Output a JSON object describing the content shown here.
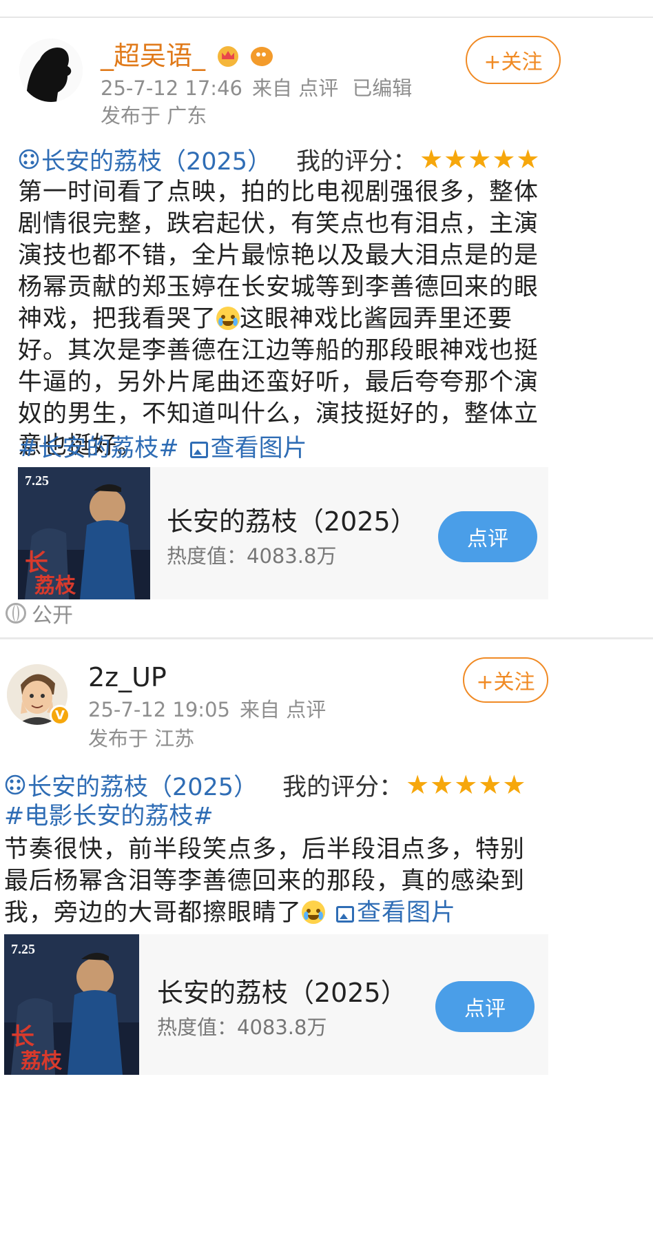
{
  "posts": [
    {
      "username": "_超吴语_",
      "datetime": "25-7-12 17:46",
      "source": "来自 点评",
      "edited": "已编辑",
      "location": "发布于 广东",
      "follow_label": "+关注",
      "movie_link": "长安的荔枝（2025）",
      "score_label": "我的评分：",
      "stars": 5,
      "text_a": "第一时间看了点映，拍的比电视剧强很多，整体剧情很完整，跌宕起伏，有笑点也有泪点，主演演技也都不错，全片最惊艳以及最大泪点是的是杨幂贡献的郑玉婷在长安城等到李善德回来的眼神戏，把我看哭了",
      "text_b": "这眼神戏比酱园弄里还要好。其次是李善德在江边等船的那段眼神戏也挺牛逼的，另外片尾曲还蛮好听，最后夸夸那个演奴的男生，不知道叫什么，演技挺好的，整体立意也挺好。",
      "tag": "#长安的荔枝#",
      "view_images": "查看图片",
      "card": {
        "title": "长安的荔枝（2025）",
        "heat": "热度值：4083.8万",
        "button": "点评",
        "poster_date": "7.25"
      },
      "visibility": "公开"
    },
    {
      "username": "2z_UP",
      "datetime": "25-7-12 19:05",
      "source": "来自 点评",
      "location": "发布于 江苏",
      "follow_label": "+关注",
      "movie_link": "长安的荔枝（2025）",
      "score_label": "我的评分：",
      "stars": 5,
      "tag": "#电影长安的荔枝#",
      "text_a": "节奏很快，前半段笑点多，后半段泪点多，特别最后杨幂含泪等李善德回来的那段，真的感染到我，旁边的大哥都擦眼睛了",
      "view_images": "查看图片",
      "card": {
        "title": "长安的荔枝（2025）",
        "heat": "热度值：4083.8万",
        "button": "点评",
        "poster_date": "7.25"
      }
    }
  ],
  "colors": {
    "link": "#2f6db5",
    "accent": "#f08a24",
    "star": "#f6a70c",
    "button": "#4a9ee8",
    "username1": "#e07a1a"
  }
}
